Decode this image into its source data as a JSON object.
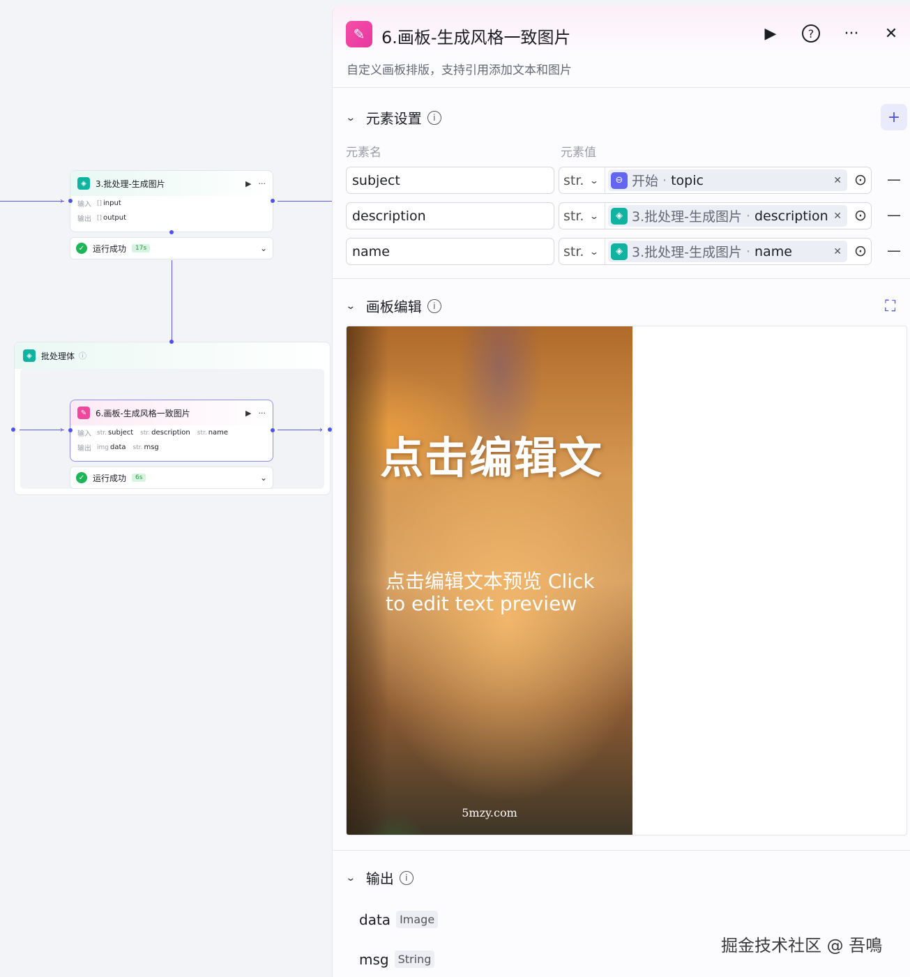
{
  "canvas": {
    "node_batch_image": {
      "icon": "layers-icon",
      "title": "3.批处理-生成图片",
      "input_label": "输入",
      "input_tag": "[]",
      "input_value": "input",
      "output_label": "输出",
      "output_tag": "[]",
      "output_value": "output",
      "status": "运行成功",
      "time": "17s"
    },
    "batch_body": {
      "title": "批处理体",
      "info": "ⓘ"
    },
    "node_canvas": {
      "title": "6.画板-生成风格一致图片",
      "input_label": "输入",
      "inputs": [
        {
          "tag": "str.",
          "name": "subject"
        },
        {
          "tag": "str.",
          "name": "description"
        },
        {
          "tag": "str.",
          "name": "name"
        }
      ],
      "output_label": "输出",
      "outputs": [
        {
          "tag": "img",
          "name": "data"
        },
        {
          "tag": "str.",
          "name": "msg"
        }
      ],
      "status": "运行成功",
      "time": "6s"
    }
  },
  "panel": {
    "icon": "canvas-edit-icon",
    "title": "6.画板-生成风格一致图片",
    "description": "自定义画板排版，支持引用添加文本和图片",
    "elements_section": {
      "title": "元素设置",
      "col_name": "元素名",
      "col_value": "元素值",
      "rows": [
        {
          "name": "subject",
          "type": "str.",
          "ref_node": "开始",
          "ref_field": "topic"
        },
        {
          "name": "description",
          "type": "str.",
          "ref_node": "3.批处理-生成图片",
          "ref_field": "description"
        },
        {
          "name": "name",
          "type": "str.",
          "ref_node": "3.批处理-生成图片",
          "ref_field": "name"
        }
      ]
    },
    "board_section": {
      "title": "画板编辑",
      "poster_title": "点击编辑文",
      "poster_body": "点击编辑文本预览 Click to edit text preview",
      "poster_watermark": "5mzy.com"
    },
    "output_section": {
      "title": "输出",
      "items": [
        {
          "name": "data",
          "type": "Image"
        },
        {
          "name": "msg",
          "type": "String"
        }
      ]
    }
  },
  "watermark": "掘金技术社区 @ 吾鳴"
}
